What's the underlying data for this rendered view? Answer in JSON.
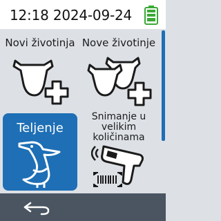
{
  "status": {
    "time": "12:18",
    "date": "2024-09-24",
    "battery_icon": "battery-full-icon",
    "battery_color": "#3aa935"
  },
  "accent_color": "#1e6fb5",
  "tiles": [
    {
      "label": "Novi životinja",
      "icon": "cow-head-add-icon"
    },
    {
      "label": "Nove životinje",
      "icon": "cow-heads-add-icon"
    },
    {
      "label": "Teljenje",
      "icon": "stork-icon"
    },
    {
      "label": "Snimanje u velikim količinama",
      "icon": "barcode-scanner-icon"
    }
  ],
  "bottom": {
    "back_icon": "back-arrow-icon"
  }
}
